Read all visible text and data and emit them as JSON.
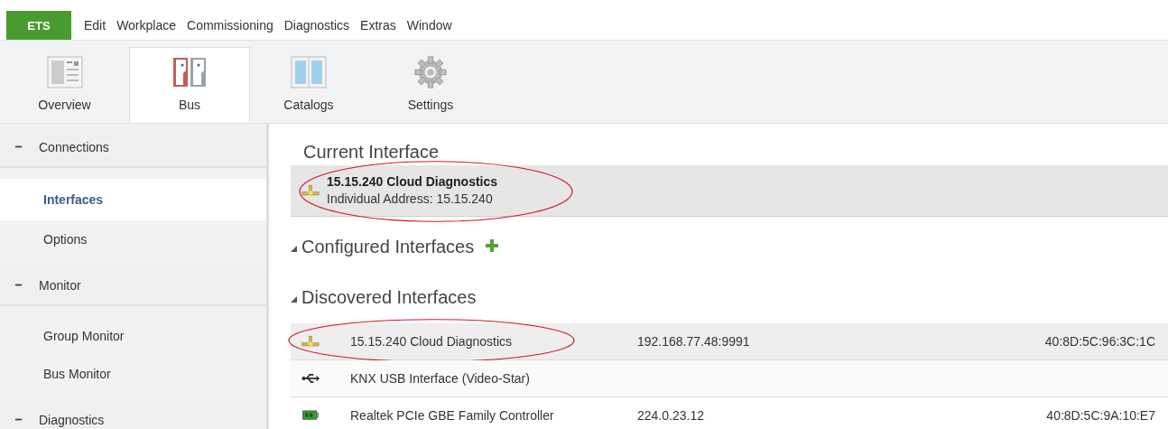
{
  "menu": {
    "app_button": "ETS",
    "items": [
      "Edit",
      "Workplace",
      "Commissioning",
      "Diagnostics",
      "Extras",
      "Window"
    ]
  },
  "tabs": [
    {
      "label": "Overview",
      "kind": "overview",
      "selected": false
    },
    {
      "label": "Bus",
      "kind": "bus",
      "selected": true
    },
    {
      "label": "Catalogs",
      "kind": "catalogs",
      "selected": false
    },
    {
      "label": "Settings",
      "kind": "settings",
      "selected": false
    }
  ],
  "sidebar": {
    "groups": [
      {
        "label": "Connections",
        "expanded": true,
        "items": [
          {
            "label": "Interfaces",
            "selected": true
          },
          {
            "label": "Options",
            "selected": false
          }
        ]
      },
      {
        "label": "Monitor",
        "expanded": true,
        "items": [
          {
            "label": "Group Monitor",
            "selected": false
          },
          {
            "label": "Bus Monitor",
            "selected": false
          }
        ]
      },
      {
        "label": "Diagnostics",
        "expanded": true
      }
    ]
  },
  "current_interface": {
    "title": "Current Interface",
    "name": "15.15.240 Cloud Diagnostics",
    "address": "Individual Address: 15.15.240",
    "kind": "network",
    "circled": true
  },
  "configured_interfaces": {
    "title": "Configured Interfaces",
    "expanded": true
  },
  "discovered_interfaces": {
    "title": "Discovered Interfaces",
    "expanded": true,
    "rows": [
      {
        "kind": "network",
        "name": "15.15.240 Cloud Diagnostics",
        "address": "192.168.77.48:9991",
        "mac": "40:8D:5C:96:3C:1C",
        "selected": true,
        "circled": true
      },
      {
        "kind": "usb",
        "name": "KNX USB Interface (Video-Star)",
        "selected": false,
        "circled": false
      },
      {
        "kind": "nic",
        "name": "Realtek PCIe GBE Family Controller",
        "address": "224.0.23.12",
        "mac": "40:8D:5C:9A:10:E7",
        "selected": false,
        "circled": false
      }
    ]
  }
}
